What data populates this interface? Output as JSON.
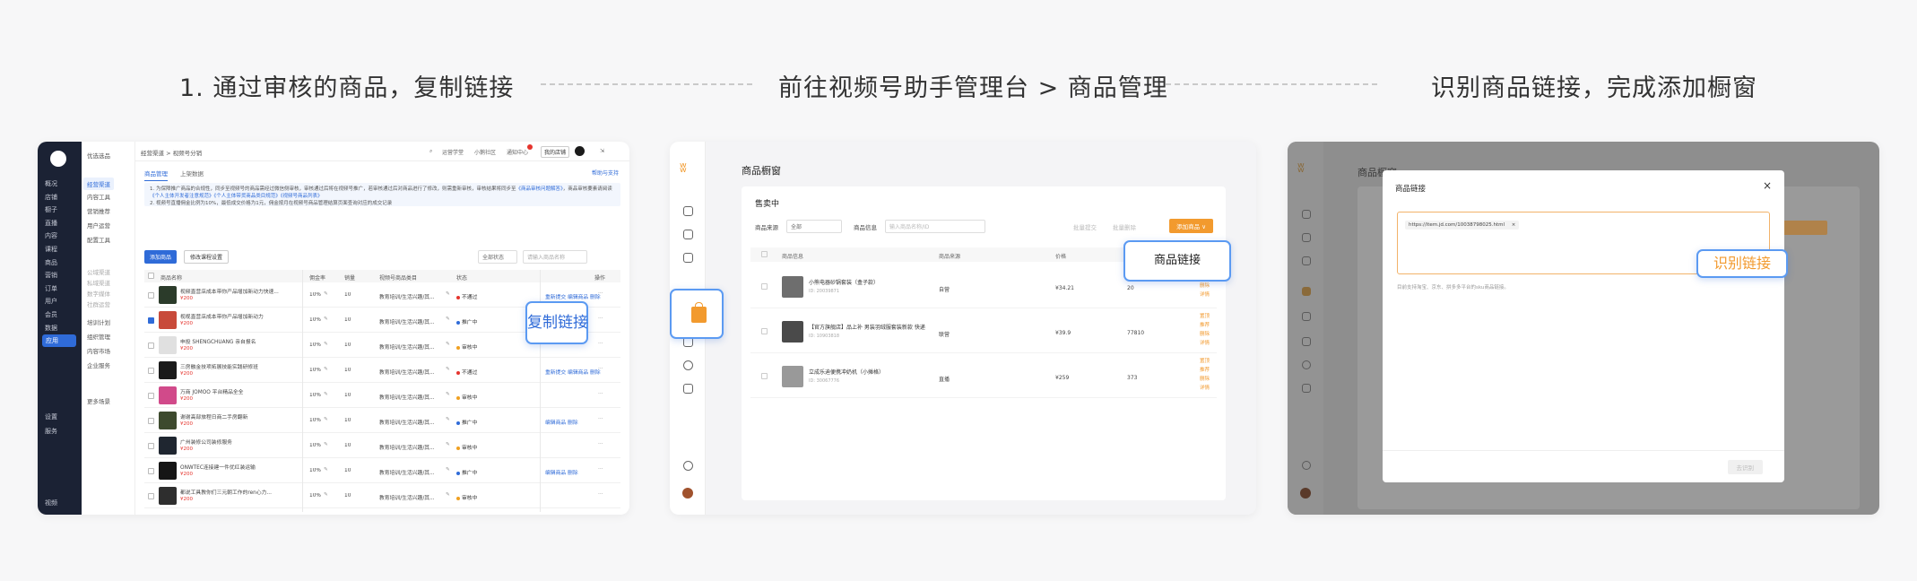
{
  "steps": [
    {
      "title": "1. 通过审核的商品，复制链接"
    },
    {
      "title": "前往视频号助手管理台 > 商品管理"
    },
    {
      "title": "识别商品链接，完成添加橱窗"
    }
  ],
  "colors": {
    "accent_blue": "#2f6bd8",
    "accent_orange": "#f29a2e",
    "dark_sidebar": "#1b2234"
  },
  "panel1": {
    "dark_nav": [
      "概况",
      "店铺",
      "橱子",
      "直播",
      "内容",
      "课程",
      "商品",
      "营销",
      "订单",
      "用户",
      "会员",
      "数据",
      "应用",
      "设置",
      "服务"
    ],
    "dark_nav_footer": "视频",
    "sub_nav": [
      {
        "label": "优选选品",
        "active": false,
        "grey": false
      },
      {
        "label": "经营渠道",
        "active": true,
        "grey": false
      },
      {
        "label": "内容工具",
        "active": false,
        "grey": false
      },
      {
        "label": "营销推荐",
        "active": false,
        "grey": false
      },
      {
        "label": "用户运营",
        "active": false,
        "grey": false
      },
      {
        "label": "配置工具",
        "active": false,
        "grey": false
      },
      {
        "label": "公域渠道",
        "active": false,
        "grey": true
      },
      {
        "label": "私域渠道",
        "active": false,
        "grey": true
      },
      {
        "label": "数字媒体",
        "active": false,
        "grey": true
      },
      {
        "label": "社群运营",
        "active": false,
        "grey": true
      },
      {
        "label": "培训计划",
        "active": false,
        "grey": false
      },
      {
        "label": "组织管理",
        "active": false,
        "grey": false
      },
      {
        "label": "内容市场",
        "active": false,
        "grey": false
      },
      {
        "label": "企业服务",
        "active": false,
        "grey": false
      },
      {
        "label": "更多场景",
        "active": false,
        "grey": false
      }
    ],
    "breadcrumb": "经营渠道 > 视频号分销",
    "topbar": {
      "search": "搜索",
      "item1": "运营学堂",
      "item2": "小鹅社区",
      "item3": "通知中心",
      "badge": "2",
      "btn": "我的店铺"
    },
    "tabs": [
      "商品管理",
      "上架数据"
    ],
    "help": "帮助与支持",
    "notice_line1": "1. 为保障推广商品的合规性，同步至视频号的商品需经过微信侧审核，审核通过后将在视频号推广，若审核通过后对商品进行了修改，则需重新审核，审核结果将同步至",
    "notice_link1": "《商品审核问题解答》",
    "notice_line2": "，商品审核要素请阅读",
    "notice_link2": "《个人主体开发者注意规范》",
    "notice_link3": "《个人主体带货商品类目规范》",
    "notice_link4": "《视频号商品列表》",
    "notice_line3": "2. 视频号直播佣金比例为10%，最低成交价格为1元，佣金按月在视频号商品管理结算页面查询对应的成交记录",
    "add_button": "添加商品",
    "batch_button": "修改课程设置",
    "filter_select": "全部状态",
    "filter_search": "请输入商品名称",
    "columns": [
      "商品名称",
      "佣金率",
      "销量",
      "视频号商品类目",
      "状态",
      "操作"
    ],
    "rows": [
      {
        "name": "视频直营店成本带你产品增加新动力快速...",
        "price": "¥200",
        "rate": "10%",
        "sales": "10",
        "category": "教育培训/生活兴趣/其...",
        "status": "不通过",
        "status_color": "#e5342d",
        "ops": "重新提交 编辑商品 删除",
        "thumb": "#2b3b2a",
        "checked": false
      },
      {
        "name": "视视直营店成本带你产品增加新动力",
        "price": "¥200",
        "rate": "10%",
        "sales": "10",
        "category": "教育培训/生活兴趣/其...",
        "status": "推广中",
        "status_color": "#2f6bd8",
        "ops": "",
        "thumb": "#c84a3a",
        "checked": true
      },
      {
        "name": "申投 SHENGCHUANG 亲自报名",
        "price": "¥200",
        "rate": "10%",
        "sales": "10",
        "category": "教育培训/生活兴趣/其...",
        "status": "审核中",
        "status_color": "#f0a020",
        "ops": "",
        "thumb": "#e0e0e0",
        "checked": false
      },
      {
        "name": "三房融金技项拓展技能实践研修班",
        "price": "¥200",
        "rate": "10%",
        "sales": "10",
        "category": "教育培训/生活兴趣/其...",
        "status": "不通过",
        "status_color": "#e5342d",
        "ops": "重新提交 编辑商品 删除",
        "thumb": "#1a1a1a",
        "checked": false
      },
      {
        "name": "万商 JOMOO 平台精品全全",
        "price": "¥200",
        "rate": "10%",
        "sales": "10",
        "category": "教育培训/生活兴趣/其...",
        "status": "审核中",
        "status_color": "#f0a020",
        "ops": "",
        "thumb": "#d14a8a",
        "checked": false
      },
      {
        "name": "谢谢高部旅程日商二手房翻新",
        "price": "¥200",
        "rate": "10%",
        "sales": "10",
        "category": "教育培训/生活兴趣/其...",
        "status": "推广中",
        "status_color": "#2f6bd8",
        "ops": "编辑商品 删除",
        "thumb": "#3d4a2e",
        "checked": false
      },
      {
        "name": "广州装修公司装修服务",
        "price": "¥200",
        "rate": "10%",
        "sales": "10",
        "category": "教育培训/生活兴趣/其...",
        "status": "审核中",
        "status_color": "#f0a020",
        "ops": "",
        "thumb": "#1f2630",
        "checked": false
      },
      {
        "name": "ONWTEC连接建一件优红装运输",
        "price": "¥200",
        "rate": "10%",
        "sales": "10",
        "category": "教育培训/生活兴趣/其...",
        "status": "推广中",
        "status_color": "#2f6bd8",
        "ops": "编辑商品 删除",
        "thumb": "#151515",
        "checked": false
      },
      {
        "name": "都说工具教你们三元朝工作的ren心力...",
        "price": "¥200",
        "rate": "10%",
        "sales": "10",
        "category": "教育培训/生活兴趣/其...",
        "status": "审核中",
        "status_color": "#f0a020",
        "ops": "",
        "thumb": "#2e2e2e",
        "checked": false
      }
    ],
    "row_more": "···",
    "callout": "复制链接"
  },
  "panel2": {
    "title": "商品橱窗",
    "subtitle": "售卖中",
    "filter_source_label": "商品来源",
    "filter_source_value": "全部",
    "filter_search_label": "商品信息",
    "filter_search_placeholder": "输入商品名称/ID",
    "link1": "批量提交",
    "link2": "批量删除",
    "add_button": "添加商品 ∨",
    "columns": [
      "商品信息",
      "商品来源",
      "价格",
      "库存",
      "操作"
    ],
    "rows": [
      {
        "name": "小熊电器砂锅套装（盒子款）",
        "id": "ID: 20039871",
        "source": "自营",
        "price": "¥34.21",
        "stock": "20",
        "ops": [
          "推荐",
          "删除",
          "详情"
        ],
        "thumb": "#6e6e6e"
      },
      {
        "name": "【官方旗舰店】品上补 男装羽绒服套装新款 快递休闲 冬季加厚保暖 300g羽",
        "id": "ID: 10903818",
        "source": "联营",
        "price": "¥39.9",
        "stock": "77810",
        "ops": [
          "置顶",
          "推荐",
          "删除",
          "详情"
        ],
        "thumb": "#4a4a4a"
      },
      {
        "name": "立成乐迪便携冲奶机（小摊格）",
        "id": "ID: 30067776",
        "source": "直播",
        "price": "¥259",
        "stock": "373",
        "ops": [
          "置顶",
          "推荐",
          "删除",
          "详情"
        ],
        "thumb": "#999999"
      }
    ],
    "callout": "商品链接"
  },
  "panel3": {
    "bg_title": "商品橱窗",
    "modal_title": "商品链接",
    "link_tag": "https://item.jd.com/10038798025.html",
    "hint": "目前支持淘宝、京东、拼多多平台的sku商品链接。",
    "confirm": "去识别",
    "callout": "识别链接"
  }
}
